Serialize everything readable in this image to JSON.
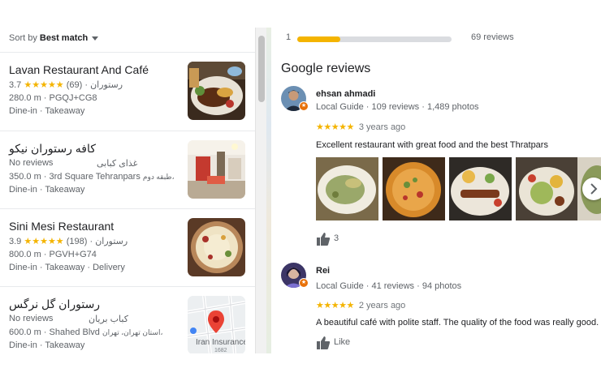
{
  "sort": {
    "prefix": "Sort by ",
    "value": "Best match"
  },
  "places": [
    {
      "name": "Lavan Restaurant And Café",
      "rating": "3.7",
      "stars": "★★★★★",
      "count": "(69)",
      "category": "رستوران",
      "line2": "280.0 m · PGQJ+CG8",
      "line3": "Dine-in · Takeaway",
      "thumb": "food-platter-photo"
    },
    {
      "name": "کافه رستوران نیکو",
      "rating": "No reviews",
      "category": "غذای کبابی",
      "line2_distance": "350.0 m · 3rd Square Tehranpars",
      "line2_extra": "طبقه دوم،",
      "line3": "Dine-in · Takeaway",
      "thumb": "restaurant-interior-photo"
    },
    {
      "name": "Sini Mesi Restaurant",
      "rating": "3.9",
      "stars": "★★★★★",
      "count": "(198)",
      "category": "رستوران",
      "line2": "800.0 m · PGVH+G74",
      "line3": "Dine-in · Takeaway · Delivery",
      "thumb": "rice-dish-photo"
    },
    {
      "name": "رستوران گل نرگس",
      "rating": "No reviews",
      "category": "کباب بریان",
      "line2_distance": "600.0 m · Shahed Blvd",
      "line2_extra": "استان تهران، تهران،",
      "line3": "Dine-in · Takeaway",
      "thumb": "map-thumbnail",
      "map_label": "Iran Insurance",
      "map_number": "1682"
    }
  ],
  "summary": {
    "bar_number": "1",
    "bar_fraction": 0.28,
    "total": "69 reviews"
  },
  "reviews_title": "Google reviews",
  "reviews": [
    {
      "name": "ehsan ahmadi",
      "meta": "Local Guide · 109 reviews · 1,489 photos",
      "stars": "★★★★★",
      "ago": "3 years ago",
      "text": "Excellent restaurant with great food  and the best Thratpars",
      "likes": "3"
    },
    {
      "name": "Rei",
      "meta": "Local Guide · 41 reviews · 94 photos",
      "stars": "★★★★★",
      "ago": "2 years ago",
      "text": "A beautiful café with polite staff. The quality of the food was really good.",
      "likes": "Like"
    }
  ],
  "colors": {
    "star": "#f4b400",
    "accent_badge": "#e8710a"
  }
}
